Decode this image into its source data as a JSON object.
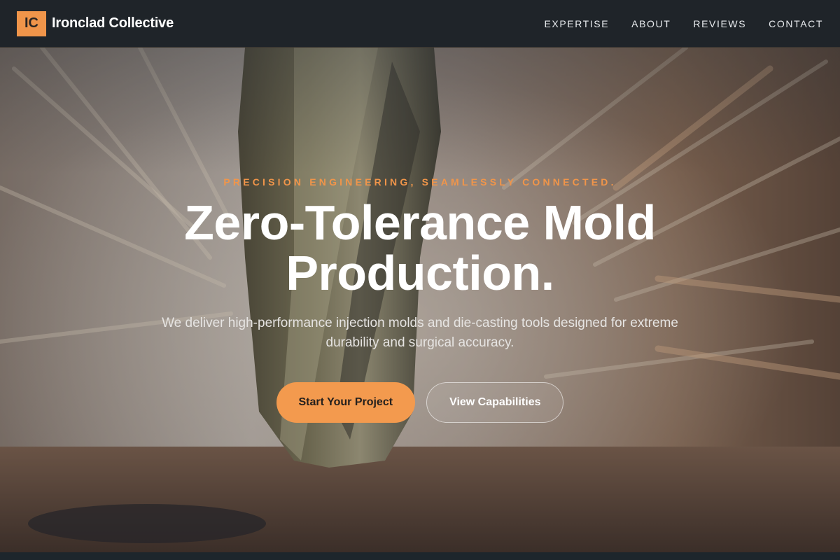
{
  "brand": {
    "logo_text": "IC",
    "name": "Ironclad Collective"
  },
  "nav": {
    "links": [
      "EXPERTISE",
      "ABOUT",
      "REVIEWS",
      "CONTACT"
    ]
  },
  "hero": {
    "eyebrow": "PRECISION ENGINEERING, SEAMLESSLY CONNECTED.",
    "headline": "Zero-Tolerance Mold Production.",
    "subtext": "We deliver high-performance injection molds and die-casting tools designed for extreme durability and surgical accuracy.",
    "primary_cta": "Start Your Project",
    "secondary_cta": "View Capabilities",
    "background_image": "drill-bit-with-sparks-photo"
  },
  "colors": {
    "accent": "#f0954a",
    "nav_bg": "#1f2429",
    "button_primary": "#f39a4e"
  }
}
